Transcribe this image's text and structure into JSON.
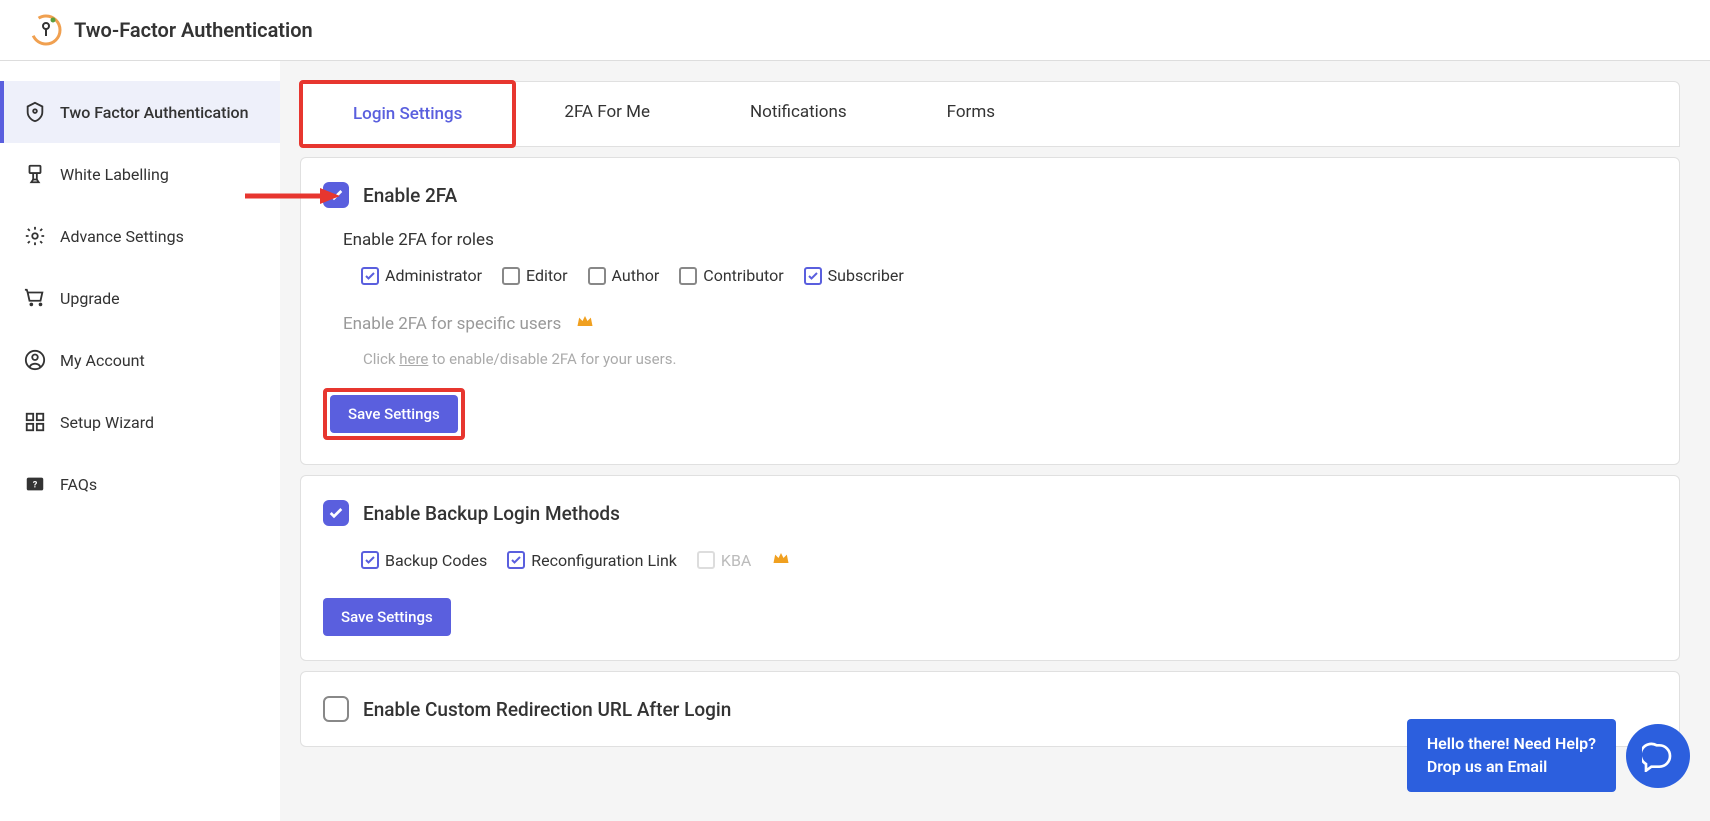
{
  "header": {
    "title": "Two-Factor Authentication"
  },
  "sidebar": {
    "items": [
      {
        "label": "Two Factor Authentication"
      },
      {
        "label": "White Labelling"
      },
      {
        "label": "Advance Settings"
      },
      {
        "label": "Upgrade"
      },
      {
        "label": "My Account"
      },
      {
        "label": "Setup Wizard"
      },
      {
        "label": "FAQs"
      }
    ]
  },
  "tabs": [
    {
      "label": "Login Settings"
    },
    {
      "label": "2FA For Me"
    },
    {
      "label": "Notifications"
    },
    {
      "label": "Forms"
    }
  ],
  "enable2fa": {
    "title": "Enable 2FA",
    "roles_label": "Enable 2FA for roles",
    "roles": [
      {
        "label": "Administrator",
        "checked": true
      },
      {
        "label": "Editor",
        "checked": false
      },
      {
        "label": "Author",
        "checked": false
      },
      {
        "label": "Contributor",
        "checked": false
      },
      {
        "label": "Subscriber",
        "checked": true
      }
    ],
    "specific_users_label": "Enable 2FA for specific users",
    "click_prefix": "Click ",
    "click_link": "here",
    "click_suffix": " to enable/disable 2FA for your users.",
    "save_label": "Save Settings"
  },
  "backup": {
    "title": "Enable Backup Login Methods",
    "methods": [
      {
        "label": "Backup Codes",
        "checked": true
      },
      {
        "label": "Reconfiguration Link",
        "checked": true
      }
    ],
    "kba_label": "KBA",
    "save_label": "Save Settings"
  },
  "redirect": {
    "title": "Enable Custom Redirection URL After Login"
  },
  "help": {
    "line1": "Hello there! Need Help?",
    "line2": "Drop us an Email"
  }
}
